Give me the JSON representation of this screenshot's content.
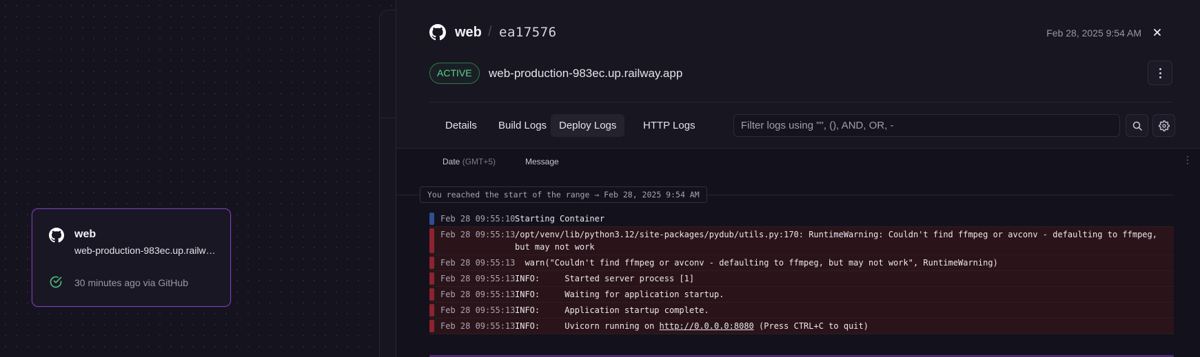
{
  "canvas": {
    "service_card": {
      "name": "web",
      "url": "web-production-983ec.up.railway.app",
      "status": "30 minutes ago via GitHub"
    }
  },
  "panel": {
    "header": {
      "service_name": "web",
      "separator": "/",
      "commit": "ea17576",
      "date": "Feb 28, 2025 9:54 AM"
    },
    "badge": "ACTIVE",
    "deploy_url": "web-production-983ec.up.railway.app",
    "tabs": [
      {
        "label": "Details"
      },
      {
        "label": "Build Logs"
      },
      {
        "label": "Deploy Logs"
      },
      {
        "label": "HTTP Logs"
      }
    ],
    "active_tab": "Deploy Logs",
    "filter": {
      "placeholder": "Filter logs using \"\", (), AND, OR, -"
    },
    "columns": {
      "date": "Date",
      "tz": "(GMT+5)",
      "message": "Message"
    },
    "range_notice": "You reached the start of the range → Feb 28, 2025 9:54 AM",
    "logs": [
      {
        "level": "info",
        "ts": "Feb 28 09:55:10",
        "msg": "Starting Container"
      },
      {
        "level": "error",
        "ts": "Feb 28 09:55:13",
        "msg": "/opt/venv/lib/python3.12/site-packages/pydub/utils.py:170: RuntimeWarning: Couldn't find ffmpeg or avconv - defaulting to ffmpeg,\nbut may not work"
      },
      {
        "level": "error",
        "ts": "Feb 28 09:55:13",
        "msg": "  warn(\"Couldn't find ffmpeg or avconv - defaulting to ffmpeg, but may not work\", RuntimeWarning)"
      },
      {
        "level": "error",
        "ts": "Feb 28 09:55:13",
        "msg": "INFO:     Started server process [1]"
      },
      {
        "level": "error",
        "ts": "Feb 28 09:55:13",
        "msg": "INFO:     Waiting for application startup."
      },
      {
        "level": "error",
        "ts": "Feb 28 09:55:13",
        "msg": "INFO:     Application startup complete."
      },
      {
        "level": "error",
        "ts": "Feb 28 09:55:13",
        "msg_prefix": "INFO:     Uvicorn running on ",
        "link": "http://0.0.0.0:8080",
        "msg_suffix": " (Press CTRL+C to quit)"
      }
    ]
  },
  "colors": {
    "accent_purple": "#7d3fbd",
    "active_green": "#5fd38b",
    "error_bar": "#8c2430",
    "info_bar": "#2f4f93"
  }
}
